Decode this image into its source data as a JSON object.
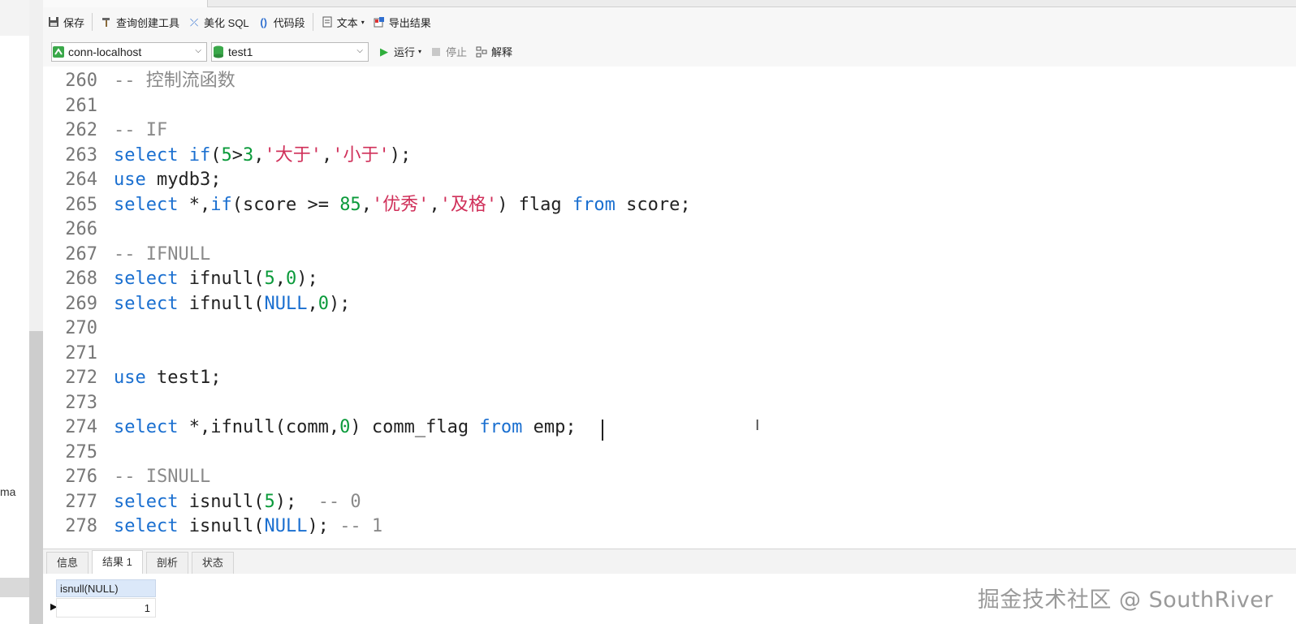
{
  "left_panel": {
    "partial_label": "ma"
  },
  "toolbar1": {
    "save": "保存",
    "query_builder": "查询创建工具",
    "beautify_sql": "美化 SQL",
    "code_snippet": "代码段",
    "text": "文本",
    "export_results": "导出结果"
  },
  "toolbar2": {
    "connection": "conn-localhost",
    "database": "test1",
    "run": "运行",
    "stop": "停止",
    "explain": "解释"
  },
  "editor": {
    "lines": [
      {
        "n": "260",
        "tokens": [
          {
            "t": "-- 控制流函数",
            "c": "cmt"
          }
        ]
      },
      {
        "n": "261",
        "tokens": []
      },
      {
        "n": "262",
        "tokens": [
          {
            "t": "-- IF",
            "c": "cmt"
          }
        ]
      },
      {
        "n": "263",
        "tokens": [
          {
            "t": "select",
            "c": "kw"
          },
          {
            "t": " ",
            "c": ""
          },
          {
            "t": "if",
            "c": "kw"
          },
          {
            "t": "(",
            "c": ""
          },
          {
            "t": "5",
            "c": "num"
          },
          {
            "t": ">",
            "c": ""
          },
          {
            "t": "3",
            "c": "num"
          },
          {
            "t": ",",
            "c": ""
          },
          {
            "t": "'大于'",
            "c": "str"
          },
          {
            "t": ",",
            "c": ""
          },
          {
            "t": "'小于'",
            "c": "str"
          },
          {
            "t": ");",
            "c": ""
          }
        ]
      },
      {
        "n": "264",
        "tokens": [
          {
            "t": "use",
            "c": "kw"
          },
          {
            "t": " mydb3;",
            "c": ""
          }
        ]
      },
      {
        "n": "265",
        "tokens": [
          {
            "t": "select",
            "c": "kw"
          },
          {
            "t": " *,",
            "c": ""
          },
          {
            "t": "if",
            "c": "kw"
          },
          {
            "t": "(score >= ",
            "c": ""
          },
          {
            "t": "85",
            "c": "num"
          },
          {
            "t": ",",
            "c": ""
          },
          {
            "t": "'优秀'",
            "c": "str"
          },
          {
            "t": ",",
            "c": ""
          },
          {
            "t": "'及格'",
            "c": "str"
          },
          {
            "t": ") flag ",
            "c": ""
          },
          {
            "t": "from",
            "c": "kw"
          },
          {
            "t": " score;",
            "c": ""
          }
        ]
      },
      {
        "n": "266",
        "tokens": []
      },
      {
        "n": "267",
        "tokens": [
          {
            "t": "-- IFNULL",
            "c": "cmt"
          }
        ]
      },
      {
        "n": "268",
        "tokens": [
          {
            "t": "select",
            "c": "kw"
          },
          {
            "t": " ifnull(",
            "c": ""
          },
          {
            "t": "5",
            "c": "num"
          },
          {
            "t": ",",
            "c": ""
          },
          {
            "t": "0",
            "c": "num"
          },
          {
            "t": ");",
            "c": ""
          }
        ]
      },
      {
        "n": "269",
        "tokens": [
          {
            "t": "select",
            "c": "kw"
          },
          {
            "t": " ifnull(",
            "c": ""
          },
          {
            "t": "NULL",
            "c": "kw"
          },
          {
            "t": ",",
            "c": ""
          },
          {
            "t": "0",
            "c": "num"
          },
          {
            "t": ");",
            "c": ""
          }
        ]
      },
      {
        "n": "270",
        "tokens": []
      },
      {
        "n": "271",
        "tokens": []
      },
      {
        "n": "272",
        "tokens": [
          {
            "t": "use",
            "c": "kw"
          },
          {
            "t": " test1;",
            "c": ""
          }
        ]
      },
      {
        "n": "273",
        "tokens": []
      },
      {
        "n": "274",
        "tokens": [
          {
            "t": "select",
            "c": "kw"
          },
          {
            "t": " *,ifnull(comm,",
            "c": ""
          },
          {
            "t": "0",
            "c": "num"
          },
          {
            "t": ") comm_flag ",
            "c": ""
          },
          {
            "t": "from",
            "c": "kw"
          },
          {
            "t": " emp; ",
            "c": ""
          }
        ]
      },
      {
        "n": "275",
        "tokens": []
      },
      {
        "n": "276",
        "tokens": [
          {
            "t": "-- ISNULL",
            "c": "cmt"
          }
        ]
      },
      {
        "n": "277",
        "tokens": [
          {
            "t": "select",
            "c": "kw"
          },
          {
            "t": " isnull(",
            "c": ""
          },
          {
            "t": "5",
            "c": "num"
          },
          {
            "t": ");  ",
            "c": ""
          },
          {
            "t": "-- 0",
            "c": "cmt"
          }
        ]
      },
      {
        "n": "278",
        "tokens": [
          {
            "t": "select",
            "c": "kw"
          },
          {
            "t": " isnull(",
            "c": ""
          },
          {
            "t": "NULL",
            "c": "kw"
          },
          {
            "t": "); ",
            "c": ""
          },
          {
            "t": "-- 1",
            "c": "cmt"
          }
        ]
      }
    ]
  },
  "bottom_tabs": [
    "信息",
    "结果 1",
    "剖析",
    "状态"
  ],
  "active_bottom_tab": 1,
  "result": {
    "column": "isnull(NULL)",
    "value": "1"
  },
  "watermark": "掘金技术社区 @ SouthRiver",
  "colors": {
    "keyword": "#1a6fd0",
    "number": "#0a9a3a",
    "string": "#d0305a",
    "comment": "#8a8a8a"
  }
}
